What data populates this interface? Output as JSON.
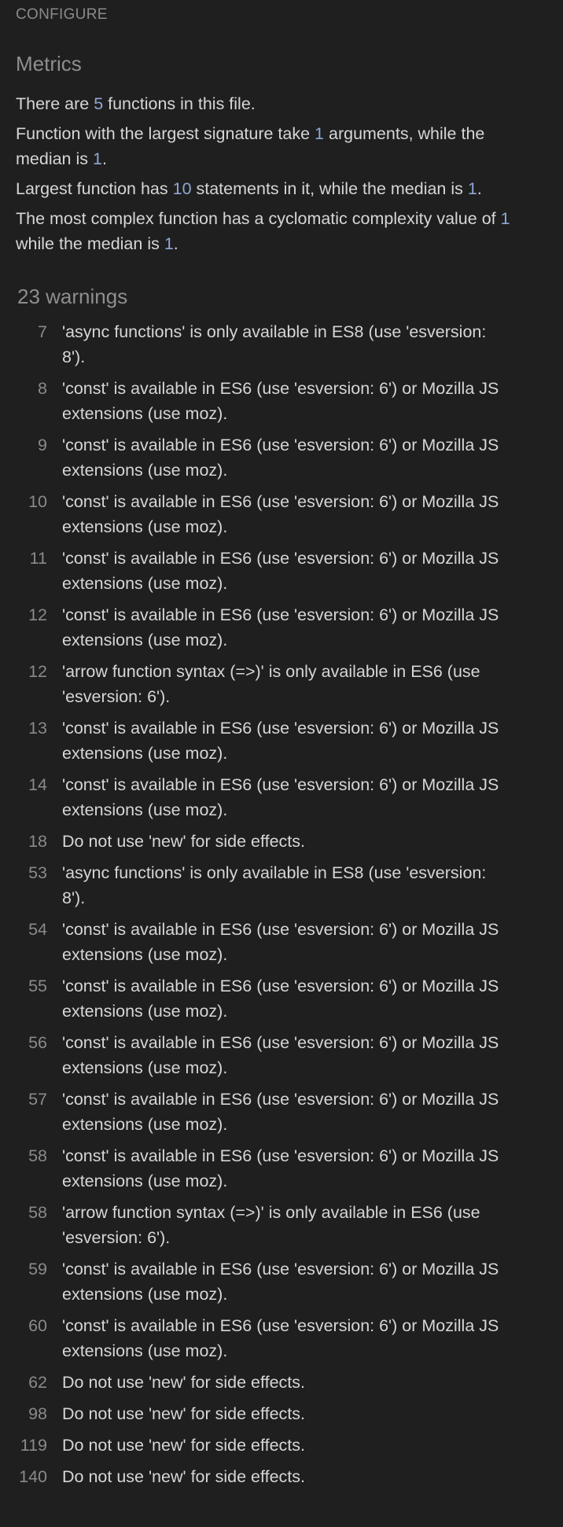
{
  "header": {
    "configure_label": "CONFIGURE"
  },
  "metrics": {
    "title": "Metrics",
    "functions_count": "5",
    "largest_signature_args": "1",
    "signature_median": "1",
    "largest_function_statements": "10",
    "statements_median": "1",
    "max_complexity": "1",
    "complexity_median": "1",
    "text": {
      "l1_pre": "There are ",
      "l1_post": " functions in this file.",
      "l2_pre": "Function with the largest signature take ",
      "l2_mid": " arguments, while the median is ",
      "l2_post": ".",
      "l3_pre": "Largest function has ",
      "l3_mid": " statements in it, while the median is ",
      "l3_post": ".",
      "l4_pre": "The most complex function has a cyclomatic complexity value of ",
      "l4_mid": " while the median is ",
      "l4_post": "."
    }
  },
  "warnings": {
    "title": "23 warnings",
    "items": [
      {
        "line": "7",
        "text": "'async functions' is only available in ES8 (use 'esversion: 8')."
      },
      {
        "line": "8",
        "text": "'const' is available in ES6 (use 'esversion: 6') or Mozilla JS extensions (use moz)."
      },
      {
        "line": "9",
        "text": "'const' is available in ES6 (use 'esversion: 6') or Mozilla JS extensions (use moz)."
      },
      {
        "line": "10",
        "text": "'const' is available in ES6 (use 'esversion: 6') or Mozilla JS extensions (use moz)."
      },
      {
        "line": "11",
        "text": "'const' is available in ES6 (use 'esversion: 6') or Mozilla JS extensions (use moz)."
      },
      {
        "line": "12",
        "text": "'const' is available in ES6 (use 'esversion: 6') or Mozilla JS extensions (use moz)."
      },
      {
        "line": "12",
        "text": "'arrow function syntax (=>)' is only available in ES6 (use 'esversion: 6')."
      },
      {
        "line": "13",
        "text": "'const' is available in ES6 (use 'esversion: 6') or Mozilla JS extensions (use moz)."
      },
      {
        "line": "14",
        "text": "'const' is available in ES6 (use 'esversion: 6') or Mozilla JS extensions (use moz)."
      },
      {
        "line": "18",
        "text": "Do not use 'new' for side effects."
      },
      {
        "line": "53",
        "text": "'async functions' is only available in ES8 (use 'esversion: 8')."
      },
      {
        "line": "54",
        "text": "'const' is available in ES6 (use 'esversion: 6') or Mozilla JS extensions (use moz)."
      },
      {
        "line": "55",
        "text": "'const' is available in ES6 (use 'esversion: 6') or Mozilla JS extensions (use moz)."
      },
      {
        "line": "56",
        "text": "'const' is available in ES6 (use 'esversion: 6') or Mozilla JS extensions (use moz)."
      },
      {
        "line": "57",
        "text": "'const' is available in ES6 (use 'esversion: 6') or Mozilla JS extensions (use moz)."
      },
      {
        "line": "58",
        "text": "'const' is available in ES6 (use 'esversion: 6') or Mozilla JS extensions (use moz)."
      },
      {
        "line": "58",
        "text": "'arrow function syntax (=>)' is only available in ES6 (use 'esversion: 6')."
      },
      {
        "line": "59",
        "text": "'const' is available in ES6 (use 'esversion: 6') or Mozilla JS extensions (use moz)."
      },
      {
        "line": "60",
        "text": "'const' is available in ES6 (use 'esversion: 6') or Mozilla JS extensions (use moz)."
      },
      {
        "line": "62",
        "text": "Do not use 'new' for side effects."
      },
      {
        "line": "98",
        "text": "Do not use 'new' for side effects."
      },
      {
        "line": "119",
        "text": "Do not use 'new' for side effects."
      },
      {
        "line": "140",
        "text": "Do not use 'new' for side effects."
      }
    ]
  },
  "colors": {
    "background": "#1f1f1f",
    "text": "#d6d6d6",
    "muted": "#8a8a8a",
    "number_accent": "#8fa7d6"
  }
}
